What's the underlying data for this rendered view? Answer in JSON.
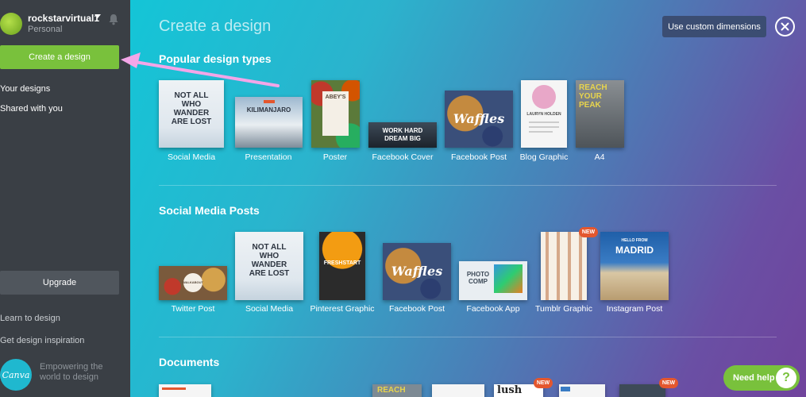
{
  "user": {
    "name": "rockstarvirtual1",
    "plan": "Personal"
  },
  "sidebar": {
    "create_label": "Create a design",
    "nav": [
      "Your designs",
      "Shared with you"
    ],
    "upgrade_label": "Upgrade",
    "links": [
      "Learn to design",
      "Get design inspiration"
    ],
    "logo_text": "Canva",
    "tagline": "Empowering the world to design"
  },
  "main": {
    "title": "Create a design",
    "custom_dimensions_label": "Use custom dimensions",
    "sections": [
      {
        "title": "Popular design types",
        "items": [
          {
            "label": "Social Media",
            "art": "NOT ALL WHO WANDER ARE LOST"
          },
          {
            "label": "Presentation",
            "art": "KILIMANJARO"
          },
          {
            "label": "Poster",
            "art": "ABEY'S"
          },
          {
            "label": "Facebook Cover",
            "art": "WORK HARD DREAM BIG"
          },
          {
            "label": "Facebook Post",
            "art": "Waffles"
          },
          {
            "label": "Blog Graphic",
            "art": "LAURYN HOLDEN"
          },
          {
            "label": "A4",
            "art": "REACH YOUR PEAK"
          }
        ]
      },
      {
        "title": "Social Media Posts",
        "items": [
          {
            "label": "Twitter Post",
            "art": "WALKABOUT"
          },
          {
            "label": "Social Media",
            "art": "NOT ALL WHO WANDER ARE LOST"
          },
          {
            "label": "Pinterest Graphic",
            "art": "FRESHSTART"
          },
          {
            "label": "Facebook Post",
            "art": "Waffles"
          },
          {
            "label": "Facebook App",
            "art": "PHOTO COMP"
          },
          {
            "label": "Tumblr Graphic",
            "art": "",
            "badge": "NEW"
          },
          {
            "label": "Instagram Post",
            "art": "MADRID",
            "art_sub": "HELLO FROM"
          }
        ]
      },
      {
        "title": "Documents",
        "items": [
          {
            "art": ""
          },
          {
            "art": "REACH"
          },
          {
            "art": ""
          },
          {
            "art": "lush",
            "badge": "NEW"
          },
          {
            "art": ""
          },
          {
            "art": "",
            "badge": "NEW"
          }
        ]
      }
    ]
  },
  "help": {
    "label": "Need help",
    "icon": "?"
  },
  "colors": {
    "accent": "#79c13c",
    "sidebar": "#3a3f45",
    "badge": "#e4572e"
  }
}
